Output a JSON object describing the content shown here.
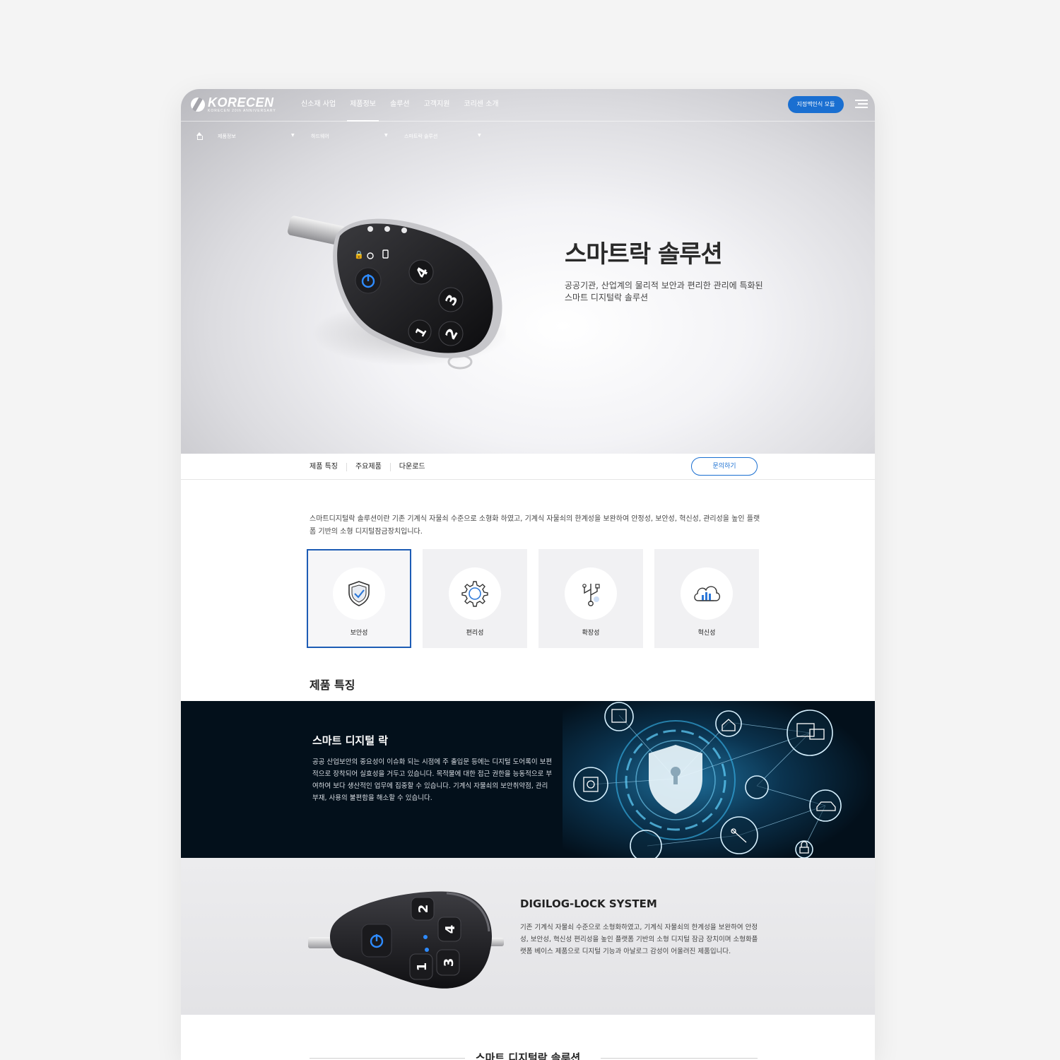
{
  "header": {
    "logo_name": "KORECEN",
    "logo_sub": "KORECEN 20th ANNIVERSARY",
    "nav": [
      "신소재 사업",
      "제품정보",
      "솔루션",
      "고객지원",
      "코리센 소개"
    ],
    "active_nav": "제품정보",
    "cta": "지정맥인식 모듈"
  },
  "breadcrumb": [
    "제품정보",
    "하드웨어",
    "스마트락 솔루션"
  ],
  "hero": {
    "title": "스마트락 솔루션",
    "subtitle_line1": "공공기관, 산업계의 물리적 보안과 편리한 관리에 특화된",
    "subtitle_line2": "스마트 디지털락 솔루션",
    "product_buttons": [
      "4",
      "3",
      "2",
      "1"
    ]
  },
  "tabs": [
    "제품 특징",
    "주요제품",
    "다운로드"
  ],
  "inquiry": "문의하기",
  "intro": "스마트디지털락 솔루션이란 기존 기계식 자물쇠 수준으로 소형화 하였고, 기계식 자물쇠의 한계성을 보완하여 안정성, 보안성, 혁신성, 관리성을 높인 플랫폼 기반의 소형 디지털잠금장치입니다.",
  "features": [
    {
      "label": "보안성",
      "icon": "shield-check-icon"
    },
    {
      "label": "편리성",
      "icon": "gear-icon"
    },
    {
      "label": "확장성",
      "icon": "usb-branch-icon"
    },
    {
      "label": "혁신성",
      "icon": "cloud-chart-icon"
    }
  ],
  "section_title": "제품 특징",
  "smart_lock": {
    "title": "스마트 디지털 락",
    "body": "공공 산업보안의 중요성이 이슈화 되는 시점에 주 출입문 등에는 디지털 도어록이 보편적으로 장착되어 실효성을 거두고 있습니다. 목적물에 대한 접근 권한을 능동적으로 부여하여 보다 생산적인 업무에 집중할 수 있습니다. 기계식 자물쇠의 보안취약점, 관리 부재, 사용의 불편함을 해소할 수 있습니다."
  },
  "digilog": {
    "title": "DIGILOG-LOCK SYSTEM",
    "body": "기존 기계식 자물쇠 수준으로 소형화하였고, 기계식 자물쇠의 한계성을 보완하여 안정성, 보안성, 혁신성 편리성을 높인 플랫폼 기반의 소형 디지털 잠금 장치이며 소형화플랫폼 베이스 제품으로 디지털 기능과 아날로그 감성이 어울려진 제품입니다.",
    "product_buttons": [
      "2",
      "4",
      "1",
      "3"
    ]
  },
  "bottom_title": "스마트 디지털락 솔루션",
  "colors": {
    "accent": "#1a6fd1",
    "dark_band": "#03101b",
    "selected_border": "#1d5cb5"
  }
}
